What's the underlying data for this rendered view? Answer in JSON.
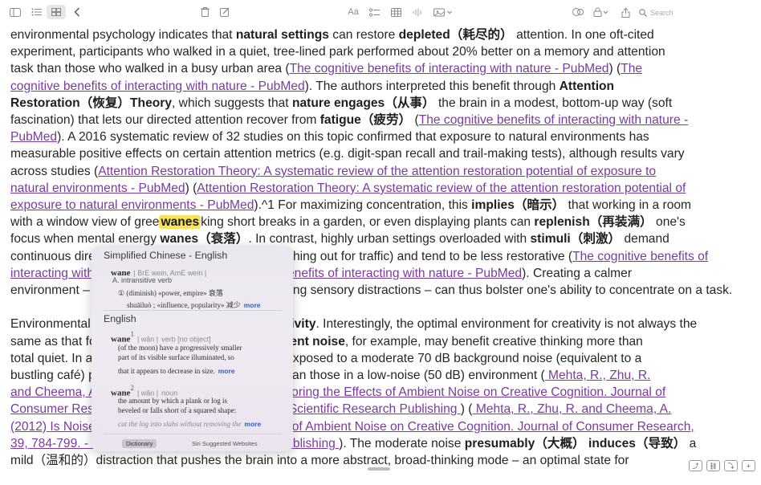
{
  "toolbar": {
    "search_placeholder": "Search"
  },
  "document": {
    "lines": [
      [
        {
          "t": "environmental psychology indicates that "
        },
        {
          "t": "natural settings",
          "b": true
        },
        {
          "t": " can restore "
        },
        {
          "t": "depleted（耗尽的）",
          "b": true
        },
        {
          "t": " attention. In one oft-cited"
        }
      ],
      [
        {
          "t": "experiment, participants who walked in a quiet, tree-lined park performed about 20% better on a memory and attention"
        }
      ],
      [
        {
          "t": "task than those who walked in a busy urban area ("
        },
        {
          "t": "The cognitive benefits of interacting with nature - PubMed",
          "l": true
        },
        {
          "t": ") ("
        },
        {
          "t": "The",
          "l": true
        }
      ],
      [
        {
          "t": "cognitive benefits of interacting with nature - PubMed",
          "l": true
        },
        {
          "t": "). The authors interpreted this benefit through "
        },
        {
          "t": "Attention",
          "b": true
        }
      ],
      [
        {
          "t": "Restoration（恢复）Theory",
          "b": true
        },
        {
          "t": ", which suggests that "
        },
        {
          "t": "nature engages（从事）",
          "b": true
        },
        {
          "t": " the brain in a modest, bottom-up way (soft"
        }
      ],
      [
        {
          "t": "fascination) that lets our directed attention recover from "
        },
        {
          "t": "fatigue（疲劳）",
          "b": true
        },
        {
          "t": " ("
        },
        {
          "t": "The cognitive benefits of interacting with nature -",
          "l": true
        }
      ],
      [
        {
          "t": "PubMed",
          "l": true
        },
        {
          "t": "). A 2016 systematic review of 32 studies on this topic confirmed that exposure to natural environments has"
        }
      ],
      [
        {
          "t": "measurable positive effects on certain attention metrics (e.g. digit-span recall and trail-making tests), although results vary"
        }
      ],
      [
        {
          "t": "across studies ("
        },
        {
          "t": "Attention Restoration Theory: A systematic review of the attention restoration potential of exposure to",
          "l": true
        }
      ],
      [
        {
          "t": "natural environments - PubMed",
          "l": true
        },
        {
          "t": ") ("
        },
        {
          "t": "Attention Restoration Theory: A systematic review of the attention restoration potential of",
          "l": true
        }
      ],
      [
        {
          "t": "exposure to natural environments - PubMed",
          "l": true
        },
        {
          "t": ").^1 For maximizing concentration, this "
        },
        {
          "t": "implies（暗示）",
          "b": true
        },
        {
          "t": " that working in a room"
        }
      ],
      [
        {
          "t": "with a window view of gree"
        },
        {
          "t": "wanes",
          "h": true
        },
        {
          "t": "king short breaks in a garden, or even displaying plants can "
        },
        {
          "t": "replenish（再装满）",
          "b": true
        },
        {
          "t": " one's"
        }
      ],
      [
        {
          "t": "focus when mental energy "
        },
        {
          "t": "wanes（衰落）",
          "b": true
        },
        {
          "t": ". In contrast, highly urban settings overloaded with "
        },
        {
          "t": "stimuli（刺激）",
          "b": true
        },
        {
          "t": " demand"
        }
      ],
      [
        {
          "t": "continuous directed attention to navigate (e.g. watching out for traffic) and tend to be less restorative ("
        },
        {
          "t": "The cognitive benefits of",
          "l": true
        }
      ],
      [
        {
          "t": "interacting with nature - PubMed",
          "l": true
        },
        {
          "t": ") ("
        },
        {
          "t": "The cognitive benefits of interacting with nature - PubMed",
          "l": true
        },
        {
          "t": "). Creating a calmer"
        }
      ],
      [
        {
          "t": "environment – by adding nature elements or reducing sensory distractions – can thus bolster one's ability to concentrate on a task."
        }
      ],
      [],
      [
        {
          "t": "Environmental factors can similarly influence "
        },
        {
          "t": "creativity",
          "b": true
        },
        {
          "t": ". Interestingly, the optimal environment for creativity is not always the"
        }
      ],
      [
        {
          "t": "same as that for focus. A moderate "
        },
        {
          "t": "levels of ambient noise",
          "b": true
        },
        {
          "t": ", for example, may benefit creative thinking more than"
        }
      ],
      [
        {
          "t": "total quiet. In a series of five experiments, people exposed to a moderate 70 dB background noise (equivalent to a"
        }
      ],
      [
        {
          "t": "bustling café) performed better on creative tasks than those in a low-noise (50 dB) environment ("
        },
        {
          "t": " Mehta, R., Zhu, R.",
          "l": true
        }
      ],
      [
        {
          "t": "and Cheema, A. (2012) Is Noise Always Bad? Exploring the Effects of Ambient Noise on Creative Cognition. Journal of",
          "l": true
        }
      ],
      [
        {
          "t": "Consumer Research, 39, 784-799. - References - Scientific Research Publishing ",
          "l": true
        },
        {
          "t": ") ("
        },
        {
          "t": " Mehta, R., Zhu, R. and Cheema, A.",
          "l": true
        }
      ],
      [
        {
          "t": "(2012) Is Noise Always Bad? Exploring the Effects of Ambient Noise on Creative Cognition. Journal of Consumer Research,",
          "l": true
        }
      ],
      [
        {
          "t": "39, 784-799. - References - Scientific Research Publishing ",
          "l": true
        },
        {
          "t": "). The moderate noise "
        },
        {
          "t": "presumably（大概）",
          "b": true
        },
        {
          "t": " "
        },
        {
          "t": "induces（导致）",
          "b": true
        },
        {
          "t": " a"
        }
      ],
      [
        {
          "t": "mild（温和的）distraction that pushes the brain into a more abstract, broad-thinking mode – an optimal state for"
        }
      ]
    ]
  },
  "dictionary": {
    "section1_title": "Simplified Chinese - English",
    "entry1_word": "wane",
    "entry1_pron": "| BrE wein, AmE wein |",
    "entry1_pos": "A. intransitive verb",
    "entry1_sense": "① (diminish) «power, empire» 衰落",
    "entry1_sense2": "shuāiluò ; «influence, popularity» 减少",
    "more": "more",
    "section2_title": "English",
    "entry2_word": "wane",
    "entry2_sup": "1",
    "entry2_pron": "| wān |",
    "entry2_pos": "verb [no object]",
    "entry2_def_l1": "(of the moon) have a progressively smaller",
    "entry2_def_l2": "part of its visible surface illuminated, so",
    "entry2_def_l3": "that it appears to decrease in size.",
    "entry3_word": "wane",
    "entry3_sup": "2",
    "entry3_pron": "| wān |",
    "entry3_pos": "noun",
    "entry3_def_l1": "the amount by which a plank or log is",
    "entry3_def_l2": "beveled or falls short of a squared shape:",
    "entry3_def_l3": "cut the log into slabs without removing the",
    "dictionary_tab": "Dictionary",
    "siri_label": "Siri Suggested Websites"
  }
}
